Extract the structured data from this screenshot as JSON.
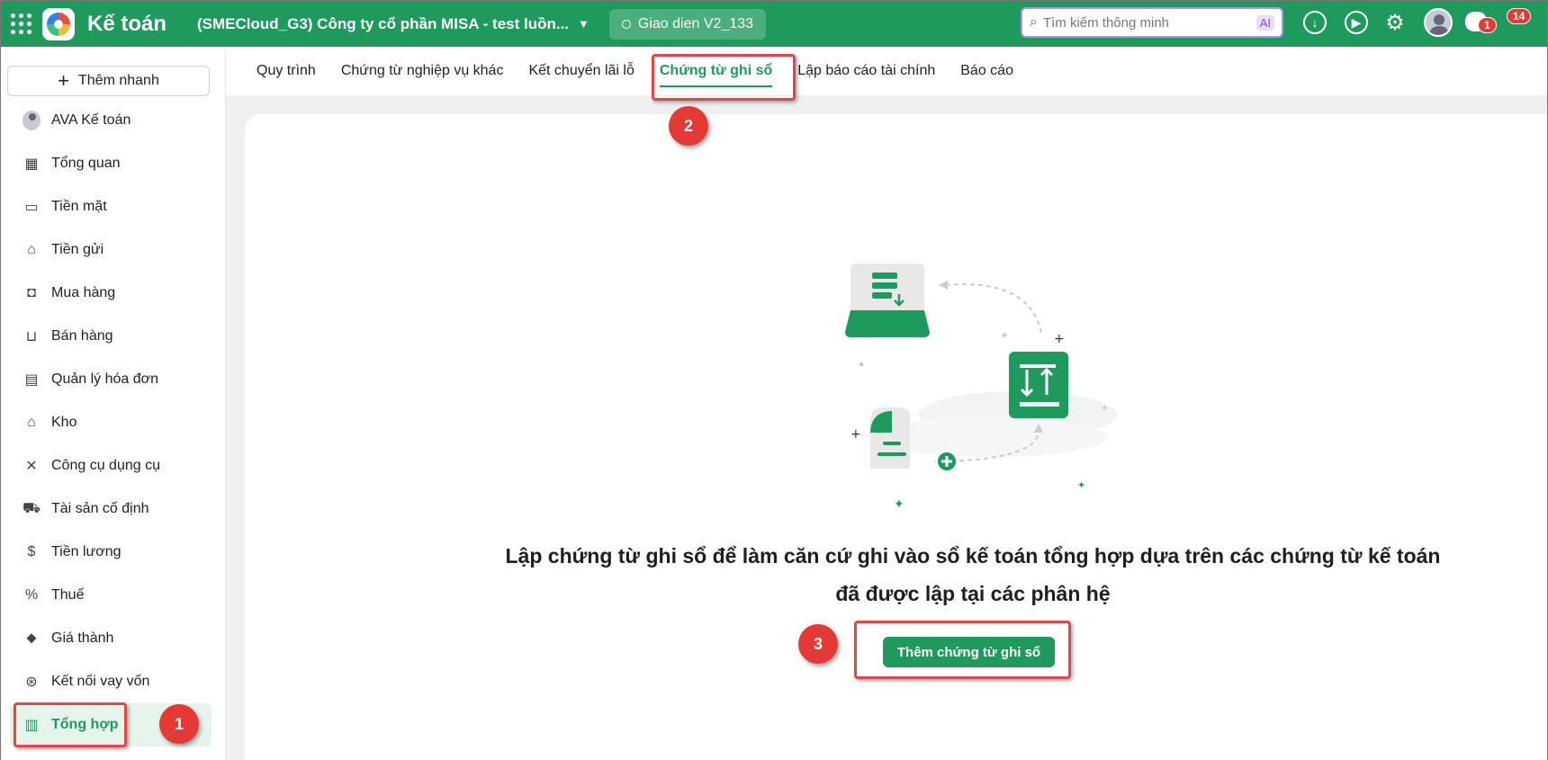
{
  "header": {
    "app_title": "Kế toán",
    "company": "(SMECloud_G3) Công ty cổ phần MISA - test luồn...",
    "theme_label": "Giao dien V2_133",
    "search_placeholder": "Tìm kiếm thông minh",
    "ai_badge": "AI",
    "chat_badge": "1",
    "notif_badge": "14",
    "brand_color": "#1e9a5c"
  },
  "sidebar": {
    "quick_add": "Thêm nhanh",
    "items": [
      {
        "label": "AVA Kế toán",
        "icon": "ava-avatar-icon"
      },
      {
        "label": "Tổng quan",
        "icon": "dashboard-icon"
      },
      {
        "label": "Tiền mặt",
        "icon": "cash-icon"
      },
      {
        "label": "Tiền gửi",
        "icon": "bank-icon"
      },
      {
        "label": "Mua hàng",
        "icon": "shopping-bag-icon"
      },
      {
        "label": "Bán hàng",
        "icon": "cart-icon"
      },
      {
        "label": "Quản lý hóa đơn",
        "icon": "invoice-icon"
      },
      {
        "label": "Kho",
        "icon": "warehouse-icon"
      },
      {
        "label": "Công cụ dụng cụ",
        "icon": "tools-icon"
      },
      {
        "label": "Tài sản cố định",
        "icon": "truck-icon"
      },
      {
        "label": "Tiền lương",
        "icon": "salary-icon"
      },
      {
        "label": "Thuế",
        "icon": "tax-icon"
      },
      {
        "label": "Giá thành",
        "icon": "price-tag-icon"
      },
      {
        "label": "Kết nối vay vốn",
        "icon": "loan-icon"
      },
      {
        "label": "Tổng hợp",
        "icon": "ledger-icon",
        "active": true
      }
    ]
  },
  "tabs": [
    {
      "label": "Quy trình"
    },
    {
      "label": "Chứng từ nghiệp vụ khác"
    },
    {
      "label": "Kết chuyển lãi lỗ"
    },
    {
      "label": "Chứng từ ghi sổ",
      "active": true
    },
    {
      "label": "Lập báo cáo tài chính"
    },
    {
      "label": "Báo cáo"
    }
  ],
  "main": {
    "description_line1": "Lập chứng từ ghi sổ để làm căn cứ ghi vào sổ kế toán tổng hợp dựa trên các chứng từ kế toán",
    "description_line2": "đã được lập tại các phân hệ",
    "add_button": "Thêm chứng từ ghi sổ"
  },
  "annotations": {
    "step1": "1",
    "step2": "2",
    "step3": "3",
    "highlight_color": "#e0474c"
  }
}
